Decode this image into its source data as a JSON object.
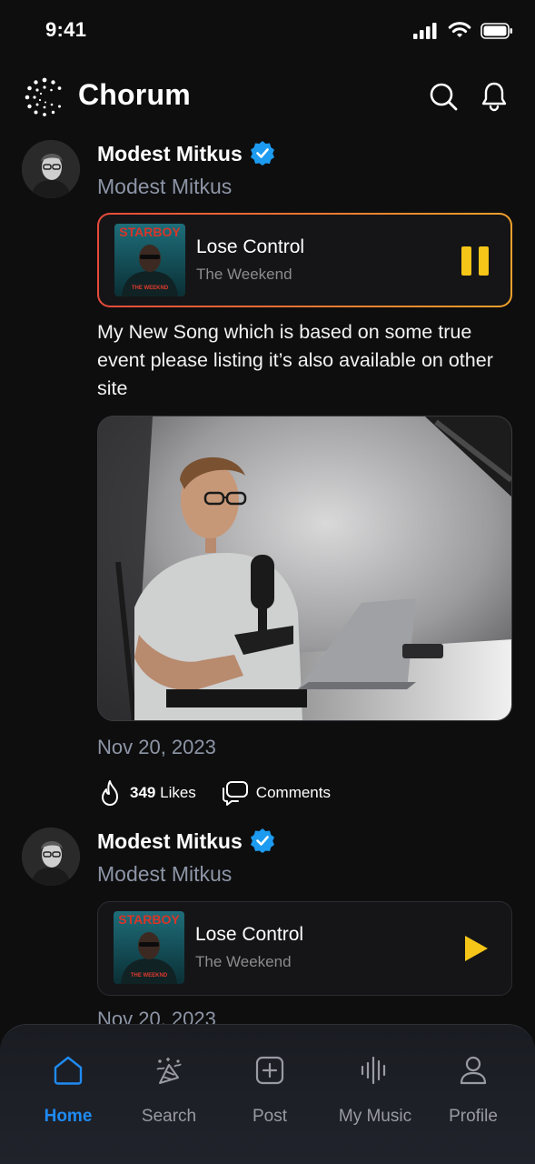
{
  "status_bar": {
    "time": "9:41"
  },
  "header": {
    "app_name": "Chorum"
  },
  "posts": [
    {
      "author": "Modest Mitkus",
      "handle": "Modest Mitkus",
      "track": {
        "title": "Lose Control",
        "artist": "The Weekend",
        "cover_text": "STARBOY",
        "cover_caption": "THE WEEKND",
        "state": "playing"
      },
      "text": "My New Song which is based on some true event please listing it’s also available on other site",
      "date": "Nov 20, 2023",
      "likes_count": "349",
      "likes_label": "Likes",
      "comments_label": "Comments"
    },
    {
      "author": "Modest Mitkus",
      "handle": "Modest Mitkus",
      "track": {
        "title": "Lose Control",
        "artist": "The Weekend",
        "cover_text": "STARBOY",
        "cover_caption": "THE WEEKND",
        "state": "paused"
      },
      "date": "Nov 20, 2023"
    }
  ],
  "nav": {
    "items": [
      {
        "label": "Home",
        "icon": "home-icon",
        "active": true
      },
      {
        "label": "Search",
        "icon": "party-icon",
        "active": false
      },
      {
        "label": "Post",
        "icon": "plus-square-icon",
        "active": false
      },
      {
        "label": "My Music",
        "icon": "waveform-icon",
        "active": false
      },
      {
        "label": "Profile",
        "icon": "user-icon",
        "active": false
      }
    ]
  },
  "colors": {
    "accent": "#1f8bf3",
    "play": "#f5c518",
    "verified": "#1d9bf0",
    "muted": "#8d95a6"
  }
}
